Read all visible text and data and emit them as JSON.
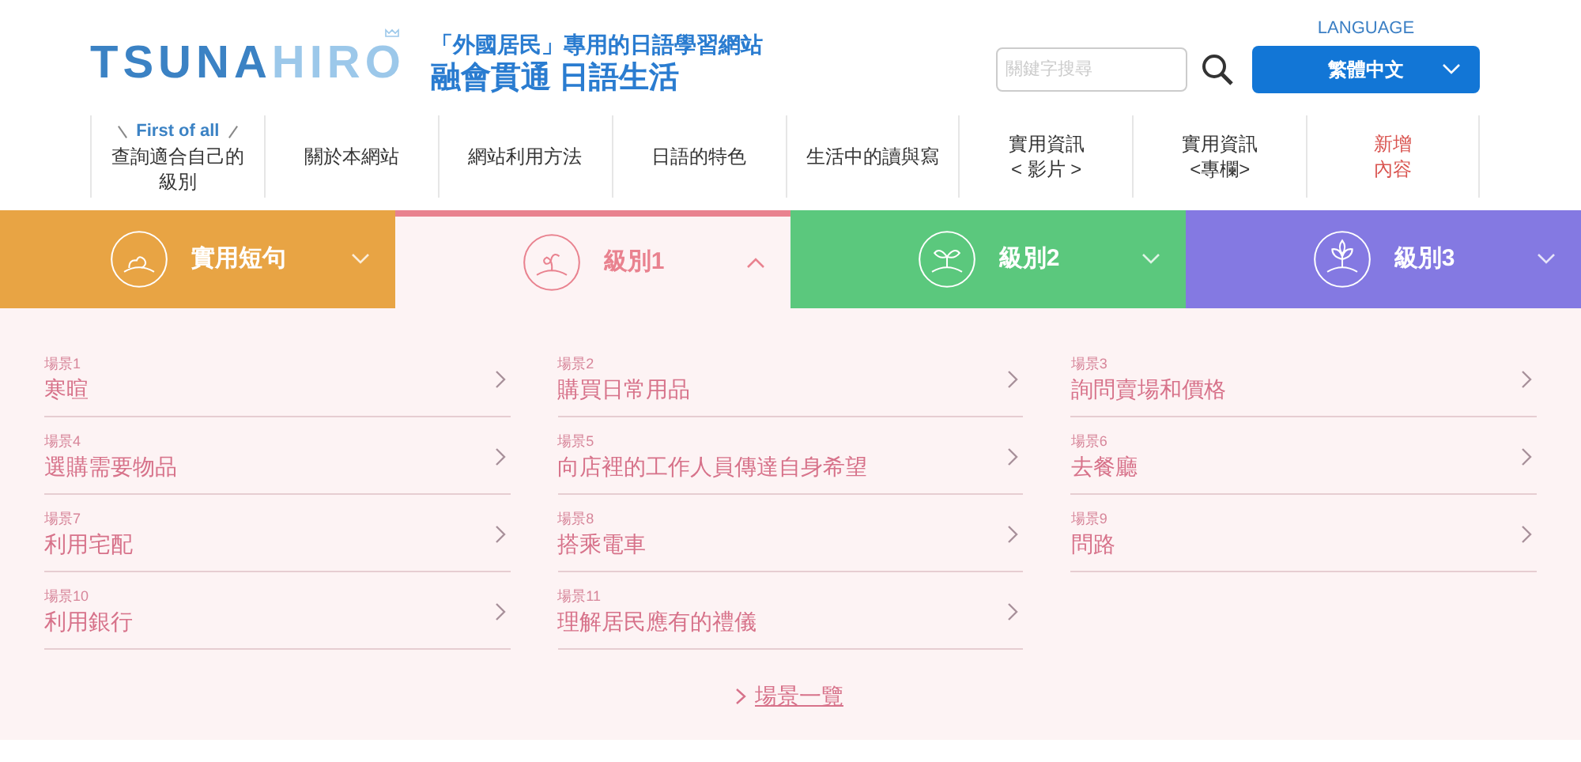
{
  "logo": {
    "primary": "TSUNA",
    "secondary": "HIRO"
  },
  "tagline": {
    "line1": "「外國居民」專用的日語學習網站",
    "line2": "融會貫通 日語生活"
  },
  "search": {
    "placeholder": "關鍵字搜尋"
  },
  "language": {
    "label": "LANGUAGE",
    "value": "繁體中文"
  },
  "nav": [
    {
      "kind": "intro",
      "kicker": "First of all",
      "lines": [
        "查詢適合自己的",
        "級別"
      ]
    },
    {
      "kind": "normal",
      "lines": [
        "關於本網站"
      ]
    },
    {
      "kind": "normal",
      "lines": [
        "網站利用方法"
      ]
    },
    {
      "kind": "normal",
      "lines": [
        "日語的特色"
      ]
    },
    {
      "kind": "normal",
      "lines": [
        "生活中的讀與寫"
      ]
    },
    {
      "kind": "normal",
      "lines": [
        "實用資訊",
        "< 影片 >"
      ]
    },
    {
      "kind": "normal",
      "lines": [
        "實用資訊",
        "<專欄>"
      ]
    },
    {
      "kind": "new",
      "lines": [
        "新增",
        "內容"
      ]
    }
  ],
  "tabs": [
    {
      "label": "實用短句",
      "color": "#e8a444",
      "kind": "seed",
      "selected": false
    },
    {
      "label": "級別1",
      "color": "#e9828f",
      "kind": "sprout",
      "selected": true
    },
    {
      "label": "級別2",
      "color": "#5bc87d",
      "kind": "seedling",
      "selected": false
    },
    {
      "label": "級別3",
      "color": "#8479e2",
      "kind": "tree",
      "selected": false
    }
  ],
  "scenes": [
    {
      "number": "場景1",
      "title": "寒暄"
    },
    {
      "number": "場景2",
      "title": "購買日常用品"
    },
    {
      "number": "場景3",
      "title": "詢問賣場和價格"
    },
    {
      "number": "場景4",
      "title": "選購需要物品"
    },
    {
      "number": "場景5",
      "title": "向店裡的工作人員傳達自身希望"
    },
    {
      "number": "場景6",
      "title": "去餐廳"
    },
    {
      "number": "場景7",
      "title": "利用宅配"
    },
    {
      "number": "場景8",
      "title": "搭乘電車"
    },
    {
      "number": "場景9",
      "title": "問路"
    },
    {
      "number": "場景10",
      "title": "利用銀行"
    },
    {
      "number": "場景11",
      "title": "理解居民應有的禮儀"
    }
  ],
  "all_scenes_link": "場景一覽"
}
